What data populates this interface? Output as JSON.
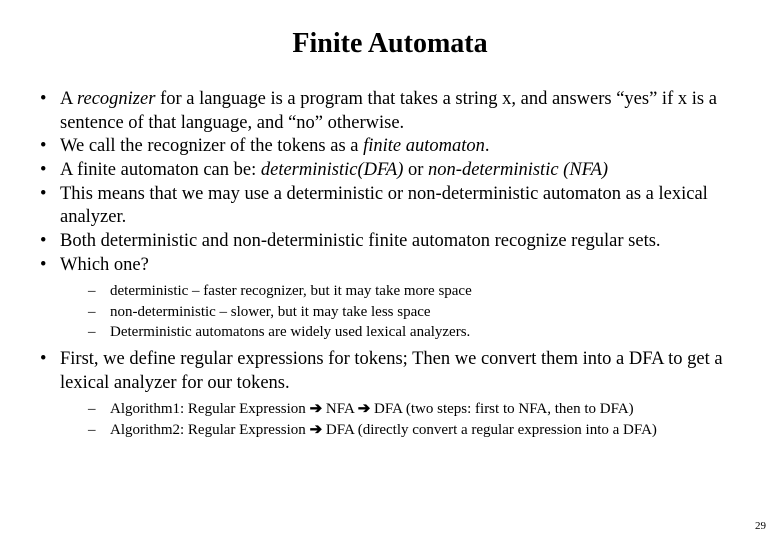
{
  "title": "Finite Automata",
  "bullets": {
    "b1a": "A ",
    "b1_em": "recognizer",
    "b1b": " for a language is a program that takes a string x, and answers “yes” if x is a sentence of that language, and “no” otherwise.",
    "b2a": "We call the recognizer of the tokens as a ",
    "b2_em": "finite automaton",
    "b2b": ".",
    "b3a": "A finite automaton can be: ",
    "b3_em1": "deterministic(DFA) ",
    "b3mid": "or ",
    "b3_em2": "non-deterministic (NFA)",
    "b4": "This means that we may use a deterministic or non-deterministic automaton as a lexical analyzer.",
    "b5": "Both deterministic and non-deterministic finite automaton recognize regular sets.",
    "b6": "Which one?",
    "b7": "First, we define regular expressions for tokens; Then we convert them into a DFA to get a lexical analyzer for our tokens."
  },
  "sub1": {
    "s1": "deterministic – faster recognizer, but it may take more space",
    "s2": "non-deterministic – slower, but it may take less space",
    "s3": "Deterministic automatons are widely used lexical analyzers."
  },
  "sub2": {
    "s1a": "Algorithm1:  Regular Expression  ",
    "arrow": "➔",
    "s1b": "  NFA ",
    "s1c": " DFA  (two steps: first to NFA, then to DFA)",
    "s2a": "Algorithm2:  Regular Expression ",
    "s2b": " DFA   (directly convert a regular expression into a DFA)"
  },
  "page_number": "29"
}
